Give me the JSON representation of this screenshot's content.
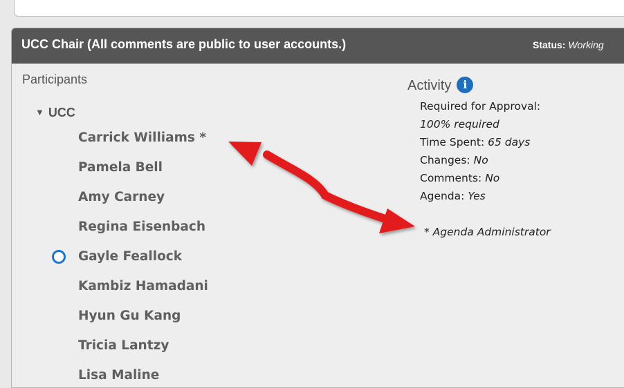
{
  "panel": {
    "title": "UCC Chair (All comments are public to user accounts.)",
    "status_label": "Status:",
    "status_value": "Working"
  },
  "participants": {
    "heading": "Participants",
    "group": {
      "toggle_glyph": "▼",
      "name": "UCC",
      "members": [
        {
          "name": "Carrick Williams *"
        },
        {
          "name": "Pamela Bell"
        },
        {
          "name": "Amy Carney"
        },
        {
          "name": "Regina Eisenbach"
        },
        {
          "name": "Gayle Feallock",
          "status_icon": "open-circle-icon"
        },
        {
          "name": "Kambiz Hamadani"
        },
        {
          "name": "Hyun Gu Kang"
        },
        {
          "name": "Tricia Lantzy"
        },
        {
          "name": "Lisa Maline"
        }
      ]
    }
  },
  "activity": {
    "heading": "Activity",
    "info_icon": "i",
    "required_label": "Required for Approval:",
    "required_value": "100% required",
    "time_label": "Time Spent:",
    "time_value": "65 days",
    "changes_label": "Changes:",
    "changes_value": "No",
    "comments_label": "Comments:",
    "comments_value": "No",
    "agenda_label": "Agenda:",
    "agenda_value": "Yes",
    "footnote": "* Agenda Administrator"
  },
  "annotation": {
    "arrow_color": "#e21b1b",
    "arrow_icon": "double-headed-arrow"
  },
  "colors": {
    "header_bg": "#565656",
    "panel_bg": "#eeeeee",
    "status_ring": "#1e76c9",
    "info_icon": "#1f6fbd"
  }
}
